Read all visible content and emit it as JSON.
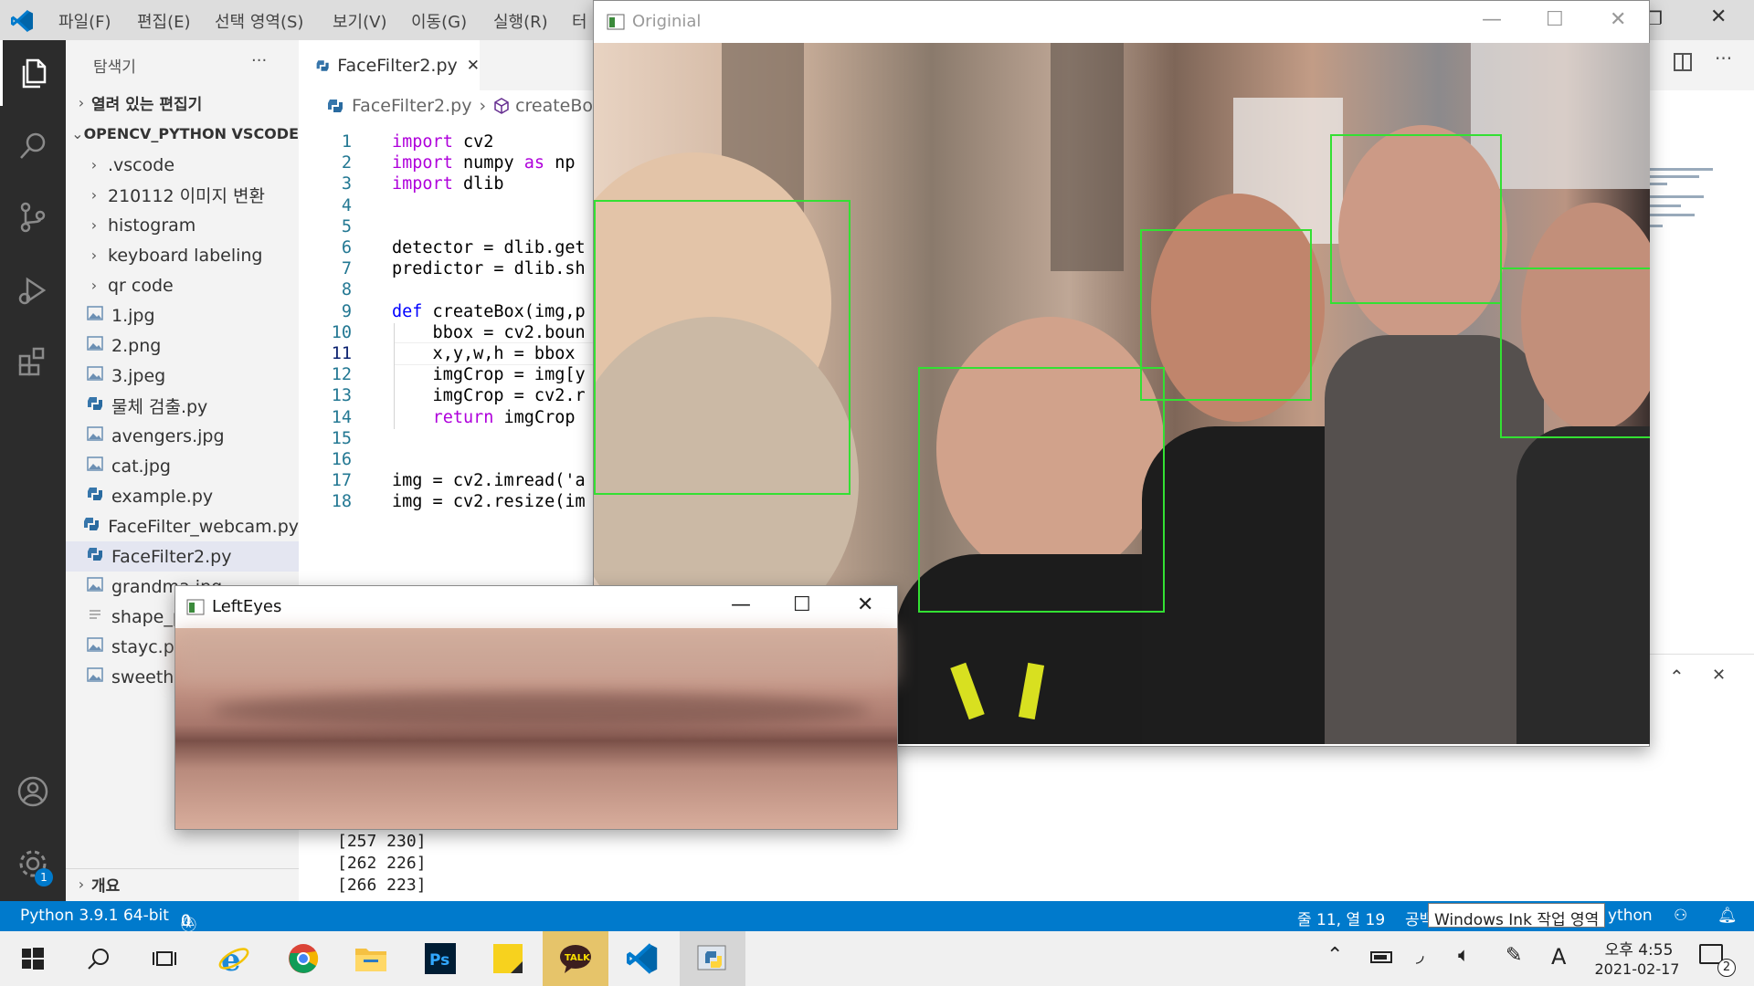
{
  "menu": [
    "파일(F)",
    "편집(E)",
    "선택 영역(S)",
    "보기(V)",
    "이동(G)",
    "실행(R)",
    "터"
  ],
  "explorer": {
    "title": "탐색기",
    "more": "···",
    "open_editors": "열려 있는 편집기",
    "project": "OPENCV_PYTHON VSCODE",
    "items": [
      {
        "label": ".vscode",
        "kind": "folder"
      },
      {
        "label": "210112 이미지 변환",
        "kind": "folder"
      },
      {
        "label": "histogram",
        "kind": "folder"
      },
      {
        "label": "keyboard labeling",
        "kind": "folder"
      },
      {
        "label": "qr code",
        "kind": "folder"
      },
      {
        "label": "1.jpg",
        "kind": "image"
      },
      {
        "label": "2.png",
        "kind": "image"
      },
      {
        "label": "3.jpeg",
        "kind": "image"
      },
      {
        "label": "물체 검출.py",
        "kind": "python"
      },
      {
        "label": "avengers.jpg",
        "kind": "image"
      },
      {
        "label": "cat.jpg",
        "kind": "image"
      },
      {
        "label": "example.py",
        "kind": "python"
      },
      {
        "label": "FaceFilter_webcam.py",
        "kind": "python"
      },
      {
        "label": "FaceFilter2.py",
        "kind": "python",
        "selected": true
      },
      {
        "label": "grandma.jpg",
        "kind": "image"
      },
      {
        "label": "shape_p",
        "kind": "text"
      },
      {
        "label": "stayc.pn",
        "kind": "image"
      },
      {
        "label": "sweetho",
        "kind": "image"
      }
    ],
    "outline": "개요"
  },
  "editor": {
    "tab": "FaceFilter2.py",
    "tab_close": "✕",
    "breadcrumb_file": "FaceFilter2.py",
    "breadcrumb_symbol": "createBox",
    "line_numbers": [
      "1",
      "2",
      "3",
      "4",
      "5",
      "6",
      "7",
      "8",
      "9",
      "10",
      "11",
      "12",
      "13",
      "14",
      "15",
      "16",
      "17",
      "18"
    ],
    "lines": [
      [
        {
          "t": "import",
          "k": "kw2"
        },
        {
          "t": " cv2"
        }
      ],
      [
        {
          "t": "import",
          "k": "kw2"
        },
        {
          "t": " numpy "
        },
        {
          "t": "as",
          "k": "kw2"
        },
        {
          "t": " np"
        }
      ],
      [
        {
          "t": "import",
          "k": "kw2"
        },
        {
          "t": " dlib"
        }
      ],
      [],
      [],
      [
        {
          "t": "detector = dlib.get"
        }
      ],
      [
        {
          "t": "predictor = dlib.sh"
        }
      ],
      [],
      [
        {
          "t": "def",
          "k": "kw"
        },
        {
          "t": " createBox(img,p"
        }
      ],
      [
        {
          "t": "    bbox = cv2.boun"
        }
      ],
      [
        {
          "t": "    x,y,w,h = bbox"
        }
      ],
      [
        {
          "t": "    imgCrop = img[y"
        }
      ],
      [
        {
          "t": "    imgCrop = cv2.r"
        }
      ],
      [
        {
          "t": "    "
        },
        {
          "t": "return",
          "k": "kw2"
        },
        {
          "t": " imgCrop"
        }
      ],
      [],
      [],
      [
        {
          "t": "img = cv2.imread('a"
        }
      ],
      [
        {
          "t": "img = cv2.resize(im"
        }
      ]
    ]
  },
  "terminal": [
    "[257 230]",
    "[262 226]",
    "[266 223]"
  ],
  "status": {
    "python": "Python 3.9.1 64-bit",
    "errors": "0",
    "warnings": "0",
    "position": "줄 11, 열 19",
    "spaces": "공백",
    "language": "ython",
    "tooltip": "Windows Ink 작업 영역"
  },
  "windows": {
    "original_title": "Originial",
    "lefteyes_title": "LeftEyes"
  },
  "taskbar": {
    "time": "오후 4:55",
    "date": "2021-02-17",
    "ime": "A",
    "notifications": "2",
    "settings_badge": "1"
  }
}
